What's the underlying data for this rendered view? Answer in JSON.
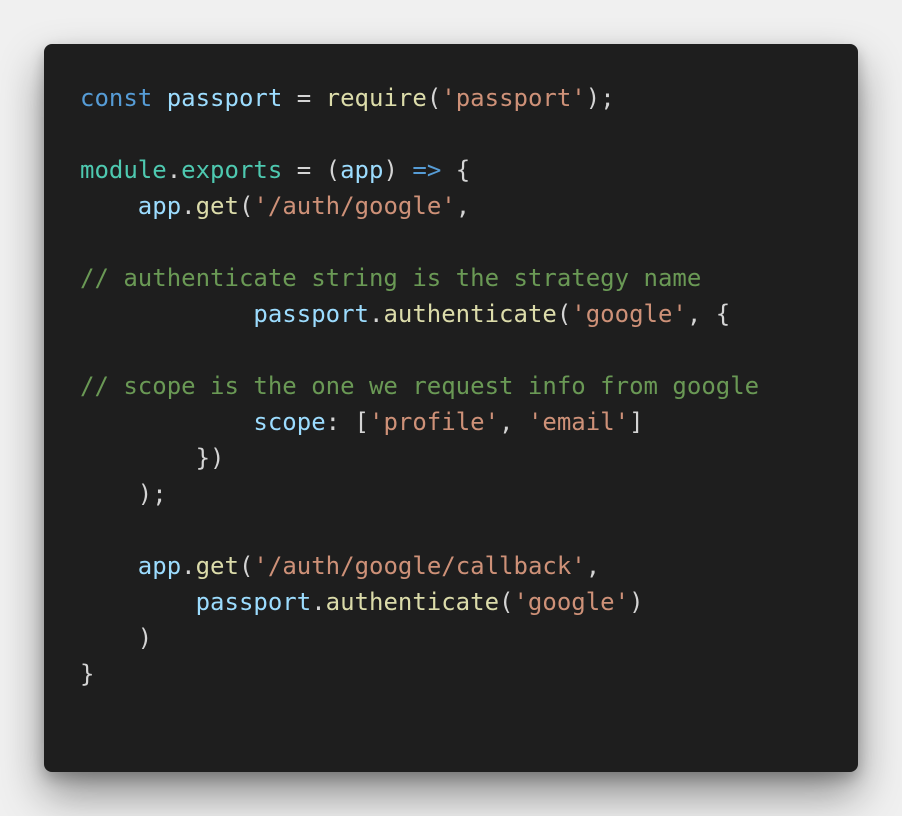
{
  "snippet": {
    "language": "javascript",
    "theme_colors": {
      "background": "#1e1e1e",
      "page_background": "#f0f0f0",
      "keyword": "#569cd6",
      "variable": "#9cdcfe",
      "function": "#dcdcaa",
      "string": "#ce9178",
      "comment": "#6a9955",
      "object": "#4ec9b0",
      "punctuation": "#d4d4d4"
    },
    "lines": [
      [
        {
          "t": "kw",
          "v": "const"
        },
        {
          "t": "pn",
          "v": " "
        },
        {
          "t": "var",
          "v": "passport"
        },
        {
          "t": "pn",
          "v": " = "
        },
        {
          "t": "fn",
          "v": "require"
        },
        {
          "t": "pn",
          "v": "("
        },
        {
          "t": "str",
          "v": "'passport'"
        },
        {
          "t": "pn",
          "v": ");"
        }
      ],
      [],
      [
        {
          "t": "obj",
          "v": "module"
        },
        {
          "t": "pn",
          "v": "."
        },
        {
          "t": "obj",
          "v": "exports"
        },
        {
          "t": "pn",
          "v": " = ("
        },
        {
          "t": "var",
          "v": "app"
        },
        {
          "t": "pn",
          "v": ") "
        },
        {
          "t": "kw",
          "v": "=>"
        },
        {
          "t": "pn",
          "v": " {"
        }
      ],
      [
        {
          "t": "pn",
          "v": "    "
        },
        {
          "t": "var",
          "v": "app"
        },
        {
          "t": "pn",
          "v": "."
        },
        {
          "t": "fn",
          "v": "get"
        },
        {
          "t": "pn",
          "v": "("
        },
        {
          "t": "str",
          "v": "'/auth/google'"
        },
        {
          "t": "pn",
          "v": ","
        }
      ],
      [],
      [
        {
          "t": "cmt",
          "v": "// authenticate string is the strategy name"
        }
      ],
      [
        {
          "t": "pn",
          "v": "            "
        },
        {
          "t": "var",
          "v": "passport"
        },
        {
          "t": "pn",
          "v": "."
        },
        {
          "t": "fn",
          "v": "authenticate"
        },
        {
          "t": "pn",
          "v": "("
        },
        {
          "t": "str",
          "v": "'google'"
        },
        {
          "t": "pn",
          "v": ", {"
        }
      ],
      [],
      [
        {
          "t": "cmt",
          "v": "// scope is the one we request info from google"
        }
      ],
      [
        {
          "t": "pn",
          "v": "            "
        },
        {
          "t": "var",
          "v": "scope"
        },
        {
          "t": "pn",
          "v": ": ["
        },
        {
          "t": "str",
          "v": "'profile'"
        },
        {
          "t": "pn",
          "v": ", "
        },
        {
          "t": "str",
          "v": "'email'"
        },
        {
          "t": "pn",
          "v": "]"
        }
      ],
      [
        {
          "t": "pn",
          "v": "        })"
        }
      ],
      [
        {
          "t": "pn",
          "v": "    );"
        }
      ],
      [],
      [
        {
          "t": "pn",
          "v": "    "
        },
        {
          "t": "var",
          "v": "app"
        },
        {
          "t": "pn",
          "v": "."
        },
        {
          "t": "fn",
          "v": "get"
        },
        {
          "t": "pn",
          "v": "("
        },
        {
          "t": "str",
          "v": "'/auth/google/callback'"
        },
        {
          "t": "pn",
          "v": ","
        }
      ],
      [
        {
          "t": "pn",
          "v": "        "
        },
        {
          "t": "var",
          "v": "passport"
        },
        {
          "t": "pn",
          "v": "."
        },
        {
          "t": "fn",
          "v": "authenticate"
        },
        {
          "t": "pn",
          "v": "("
        },
        {
          "t": "str",
          "v": "'google'"
        },
        {
          "t": "pn",
          "v": ")"
        }
      ],
      [
        {
          "t": "pn",
          "v": "    )"
        }
      ],
      [
        {
          "t": "pn",
          "v": "}"
        }
      ]
    ]
  }
}
